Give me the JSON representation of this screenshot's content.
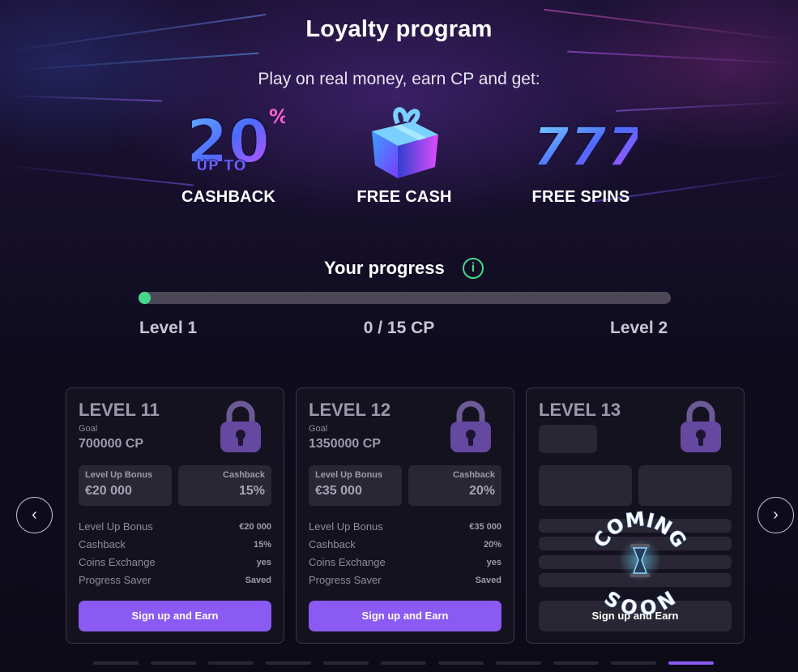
{
  "header": {
    "title": "Loyalty program",
    "subtitle": "Play on real money, earn CP and get:"
  },
  "perks": [
    {
      "icon": "cashback-20-icon",
      "art_text": "20",
      "art_sub": "UP TO",
      "art_pct": "%",
      "label": "CASHBACK"
    },
    {
      "icon": "gift-box-icon",
      "label": "FREE CASH"
    },
    {
      "icon": "slot-777-icon",
      "art_text": "777",
      "label": "FREE SPINS"
    }
  ],
  "progress": {
    "title": "Your progress",
    "info_icon": "info-icon",
    "current_level": "Level 1",
    "next_level": "Level 2",
    "points_text": "0 / 15 CP",
    "current_cp": 0,
    "target_cp": 15,
    "accent": "#45d88a"
  },
  "cards": [
    {
      "level": "LEVEL 11",
      "goal_label": "Goal",
      "goal": "700000 CP",
      "bonus_label": "Level Up Bonus",
      "bonus_value": "€20 000",
      "cashback_label": "Cashback",
      "cashback_value": "15%",
      "rows": [
        {
          "label": "Level Up Bonus",
          "value": "€20 000"
        },
        {
          "label": "Cashback",
          "value": "15%"
        },
        {
          "label": "Coins Exchange",
          "value": "yes"
        },
        {
          "label": "Progress Saver",
          "value": "Saved"
        }
      ],
      "cta": "Sign up and Earn"
    },
    {
      "level": "LEVEL 12",
      "goal_label": "Goal",
      "goal": "1350000 CP",
      "bonus_label": "Level Up Bonus",
      "bonus_value": "€35 000",
      "cashback_label": "Cashback",
      "cashback_value": "20%",
      "rows": [
        {
          "label": "Level Up Bonus",
          "value": "€35 000"
        },
        {
          "label": "Cashback",
          "value": "20%"
        },
        {
          "label": "Coins Exchange",
          "value": "yes"
        },
        {
          "label": "Progress Saver",
          "value": "Saved"
        }
      ],
      "cta": "Sign up and Earn"
    },
    {
      "level": "LEVEL 13",
      "badge": "COMING SOON",
      "cta": "Sign up and Earn"
    }
  ],
  "carousel": {
    "prev_icon": "chevron-left-icon",
    "next_icon": "chevron-right-icon",
    "prev_glyph": "‹",
    "next_glyph": "›",
    "page_count": 11,
    "active_page": 11
  },
  "colors": {
    "accent_purple": "#8a5af2",
    "accent_green": "#45d88a"
  }
}
